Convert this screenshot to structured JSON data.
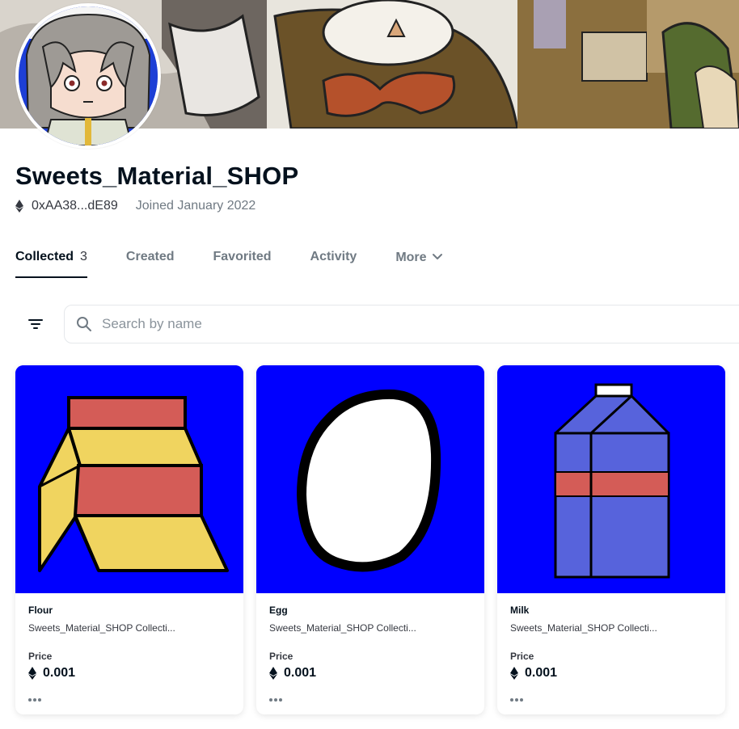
{
  "profile": {
    "name": "Sweets_Material_SHOP",
    "address": "0xAA38...dE89",
    "joined": "Joined January 2022"
  },
  "tabs": [
    {
      "label": "Collected",
      "count": "3"
    },
    {
      "label": "Created"
    },
    {
      "label": "Favorited"
    },
    {
      "label": "Activity"
    },
    {
      "label": "More"
    }
  ],
  "search": {
    "placeholder": "Search by name"
  },
  "items": [
    {
      "name": "Flour",
      "collection": "Sweets_Material_SHOP Collecti...",
      "price_label": "Price",
      "price": "0.001",
      "icon": "flour-bag-icon"
    },
    {
      "name": "Egg",
      "collection": "Sweets_Material_SHOP Collecti...",
      "price_label": "Price",
      "price": "0.001",
      "icon": "egg-icon"
    },
    {
      "name": "Milk",
      "collection": "Sweets_Material_SHOP Collecti...",
      "price_label": "Price",
      "price": "0.001",
      "icon": "milk-carton-icon"
    }
  ],
  "colors": {
    "item_background": "#0000ff",
    "text_primary": "#04111d",
    "text_secondary": "#707a83"
  }
}
